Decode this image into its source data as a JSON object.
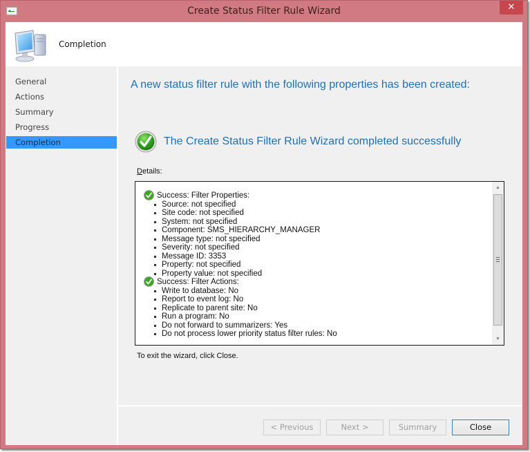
{
  "window": {
    "title": "Create Status Filter Rule Wizard",
    "close_glyph": "✕"
  },
  "header": {
    "title": "Completion"
  },
  "sidebar": {
    "items": [
      {
        "label": "General",
        "active": false
      },
      {
        "label": "Actions",
        "active": false
      },
      {
        "label": "Summary",
        "active": false
      },
      {
        "label": "Progress",
        "active": false
      },
      {
        "label": "Completion",
        "active": true
      }
    ]
  },
  "main": {
    "heading": "A new status filter rule with the following properties has been created:",
    "success_message": "The Create Status Filter Rule Wizard completed successfully",
    "details_label_first": "D",
    "details_label_rest": "etails:",
    "details": {
      "sections": [
        {
          "title": "Success: Filter Properties:",
          "items": [
            "Source: not specified",
            "Site code: not specified",
            "System: not specified",
            "Component: SMS_HIERARCHY_MANAGER",
            "Message type: not specified",
            "Severity: not specified",
            "Message ID: 3353",
            "Property: not specified",
            "Property value: not specified"
          ]
        },
        {
          "title": "Success: Filter Actions:",
          "items": [
            "Write to database: No",
            "Report to event log: No",
            "Replicate to parent site: No",
            "Run a program: No",
            "Do not forward to summarizers: Yes",
            "Do not process lower priority status filter rules: No"
          ]
        }
      ]
    },
    "exit_text": "To exit the wizard, click Close."
  },
  "footer": {
    "previous_label": "< Previous",
    "next_label": "Next >",
    "summary_label": "Summary",
    "close_label": "Close"
  },
  "colors": {
    "accent_text": "#1f6fb2",
    "selection": "#3399ff",
    "window_frame": "#d17a82",
    "close_button": "#c7474f"
  }
}
